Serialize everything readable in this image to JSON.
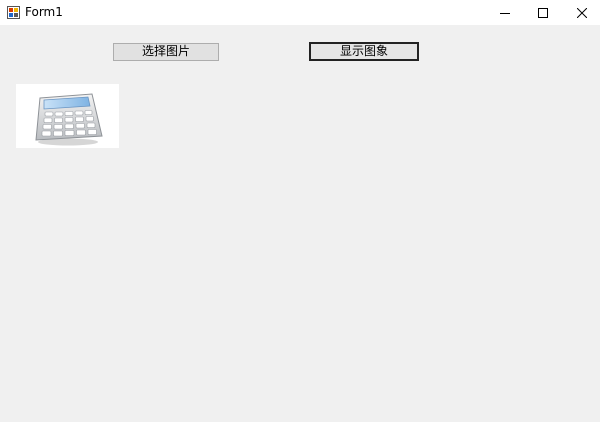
{
  "window": {
    "title": "Form1"
  },
  "buttons": {
    "select_image": "选择图片",
    "show_image": "显示图象"
  },
  "picture": {
    "icon": "calculator-icon"
  },
  "colors": {
    "background": "#f0f0f0",
    "titlebar": "#ffffff",
    "button_face": "#e1e1e1"
  }
}
